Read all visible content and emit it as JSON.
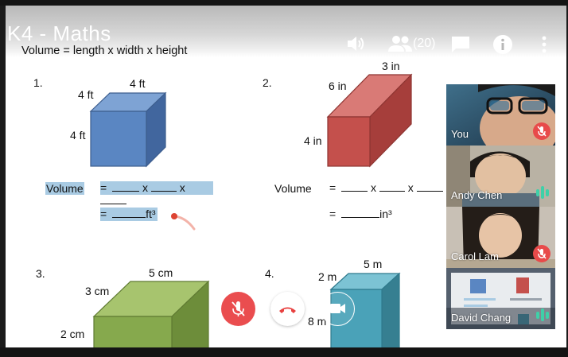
{
  "meeting": {
    "title": "K4 - Maths"
  },
  "toolbar": {
    "people_count": "(20)",
    "icons": [
      "speaker-icon",
      "people-icon",
      "chat-icon",
      "info-icon",
      "more-vert-icon"
    ]
  },
  "slide": {
    "formula": "Volume = length x width x height",
    "p1": {
      "num": "1.",
      "dim_top": "4 ft",
      "dim_left": "4 ft",
      "dim_side": "4 ft",
      "volume_label": "Volume",
      "eq1": "=",
      "x1": "x",
      "x2": "x",
      "eq2": "=",
      "unit": "ft³"
    },
    "p2": {
      "num": "2.",
      "dim_top": "3 in",
      "dim_left": "6 in",
      "dim_side": "4 in",
      "volume_label": "Volume",
      "eq1": "=",
      "x1": "x",
      "x2": "x",
      "eq2": "=",
      "unit": "in³"
    },
    "p3": {
      "num": "3.",
      "dim_top": "5 cm",
      "dim_left": "3 cm",
      "dim_side": "2 cm"
    },
    "p4": {
      "num": "4.",
      "dim_top": "5 m",
      "dim_left": "2 m",
      "dim_side": "8 m"
    }
  },
  "participants": [
    {
      "name": "You",
      "status": "muted"
    },
    {
      "name": "Andy Chen",
      "status": "speaking"
    },
    {
      "name": "Carol Lam",
      "status": "muted"
    },
    {
      "name": "David Chang",
      "status": "speaking"
    }
  ],
  "call_controls": {
    "buttons": [
      "mute-microphone",
      "end-call",
      "camera"
    ]
  },
  "colors": {
    "blue_cube": "#5a86c2",
    "red_cube": "#c4504c",
    "green_cube": "#86a94d",
    "teal_cube": "#4aa2b8",
    "mute_red": "#ea4d4f",
    "highlight": "#a9cbe3"
  }
}
